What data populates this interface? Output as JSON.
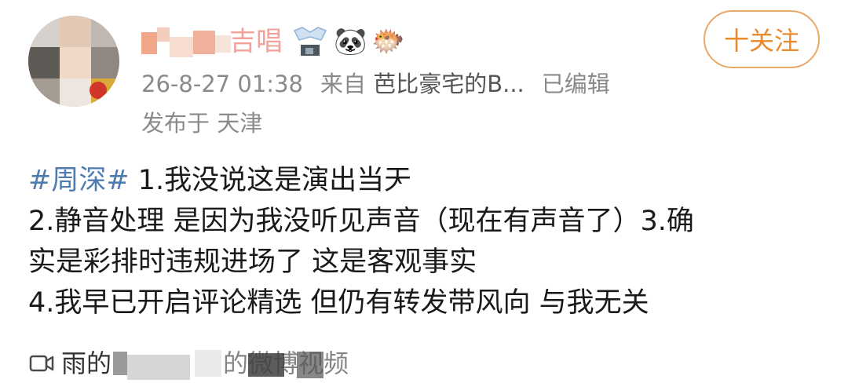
{
  "post": {
    "author": {
      "name_visible_fragment": "吉唱",
      "emoji_1": "🐼",
      "emoji_2": "🐡"
    },
    "follow_button": {
      "label": "十关注"
    },
    "meta": {
      "timestamp": "26-8-27 01:38",
      "source_prefix": "来自",
      "source": "芭比豪宅的B...",
      "edited": "已编辑",
      "location": "发布于 天津"
    },
    "content": {
      "hashtag": "#周深#",
      "line1_rest": " 1.我没说这是演出当天",
      "line2": "2.静音处理 是因为我没听见声音（现在有声音了）3.确",
      "line3": "实是彩排时违规进场了 这是客观事实",
      "line4": "4.我早已开启评论精选 但仍有转发带风向 与我无关"
    },
    "video_link": {
      "prefix": "雨的",
      "suffix": "的微博视频"
    }
  },
  "colors": {
    "link": "#4f7cb0",
    "follow_accent": "#e98b2a",
    "meta_text": "#8a8a8a"
  },
  "icons": [
    "avatar",
    "panda-emoji",
    "pufferfish-emoji",
    "video-camera-icon"
  ]
}
